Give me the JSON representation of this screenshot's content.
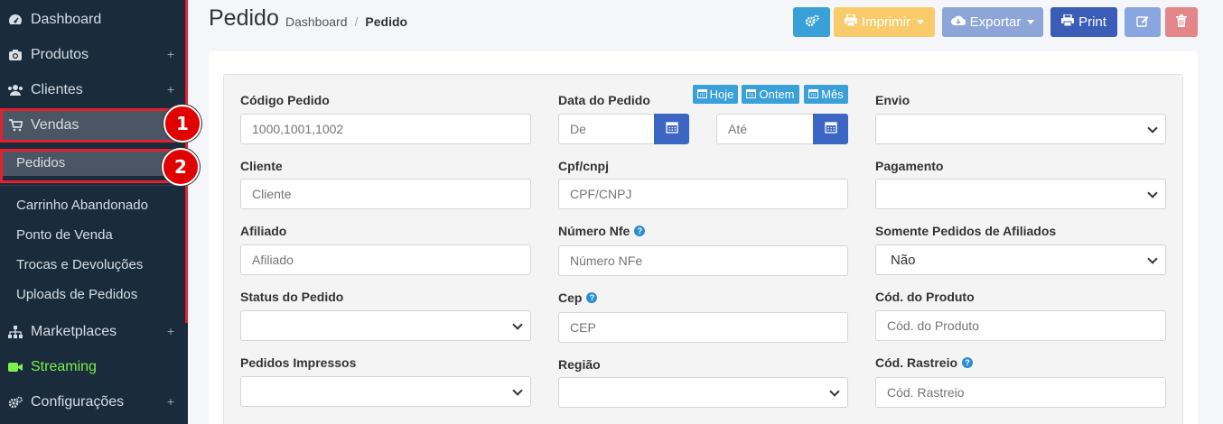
{
  "sidebar": {
    "items": [
      {
        "label": "Dashboard",
        "icon": "dashboard-icon",
        "plus": ""
      },
      {
        "label": "Produtos",
        "icon": "camera-icon",
        "plus": "+"
      },
      {
        "label": "Clientes",
        "icon": "users-icon",
        "plus": "+"
      },
      {
        "label": "Vendas",
        "icon": "cart-icon",
        "plus": ""
      },
      {
        "label": "Marketplaces",
        "icon": "sitemap-icon",
        "plus": "+"
      },
      {
        "label": "Streaming",
        "icon": "video-icon",
        "plus": ""
      },
      {
        "label": "Configurações",
        "icon": "gears-icon",
        "plus": "+"
      }
    ],
    "subitems": [
      "Pedidos",
      "Carrinho Abandonado",
      "Ponto de Venda",
      "Trocas e Devoluções",
      "Uploads de Pedidos"
    ],
    "markers": [
      "1",
      "2"
    ]
  },
  "header": {
    "title": "Pedido",
    "breadcrumb": [
      "Dashboard",
      "/",
      "Pedido"
    ]
  },
  "toolbar": {
    "imprimir": "Imprimir",
    "exportar": "Exportar",
    "print": "Print",
    "colors": {
      "settings": "#3aa0d8",
      "imprimir": "#f9cb6a",
      "exportar": "#8da5d8",
      "print": "#3b5db8",
      "edit": "#8aa6e0",
      "delete": "#e3868a"
    }
  },
  "filters": {
    "codigo_pedido": {
      "label": "Código Pedido",
      "placeholder": "1000,1001,1002"
    },
    "data_pedido": {
      "label": "Data do Pedido",
      "from_placeholder": "De",
      "to_placeholder": "Até",
      "quick": [
        "Hoje",
        "Ontem",
        "Mês"
      ]
    },
    "envio": {
      "label": "Envio",
      "value": ""
    },
    "cliente": {
      "label": "Cliente",
      "placeholder": "Cliente"
    },
    "cpf_cnpj": {
      "label": "Cpf/cnpj",
      "placeholder": "CPF/CNPJ"
    },
    "pagamento": {
      "label": "Pagamento",
      "value": ""
    },
    "afiliado": {
      "label": "Afiliado",
      "placeholder": "Afiliado"
    },
    "numero_nfe": {
      "label": "Número Nfe",
      "placeholder": "Número NFe"
    },
    "somente_afiliados": {
      "label": "Somente Pedidos de Afiliados",
      "value": "Não"
    },
    "status_pedido": {
      "label": "Status do Pedido",
      "value": ""
    },
    "cep": {
      "label": "Cep",
      "placeholder": "CEP"
    },
    "cod_produto": {
      "label": "Cód. do Produto",
      "placeholder": "Cód. do Produto"
    },
    "pedidos_impressos": {
      "label": "Pedidos Impressos",
      "value": ""
    },
    "regiao": {
      "label": "Região",
      "value": ""
    },
    "cod_rastreio": {
      "label": "Cód. Rastreio",
      "placeholder": "Cód. Rastreio"
    }
  }
}
